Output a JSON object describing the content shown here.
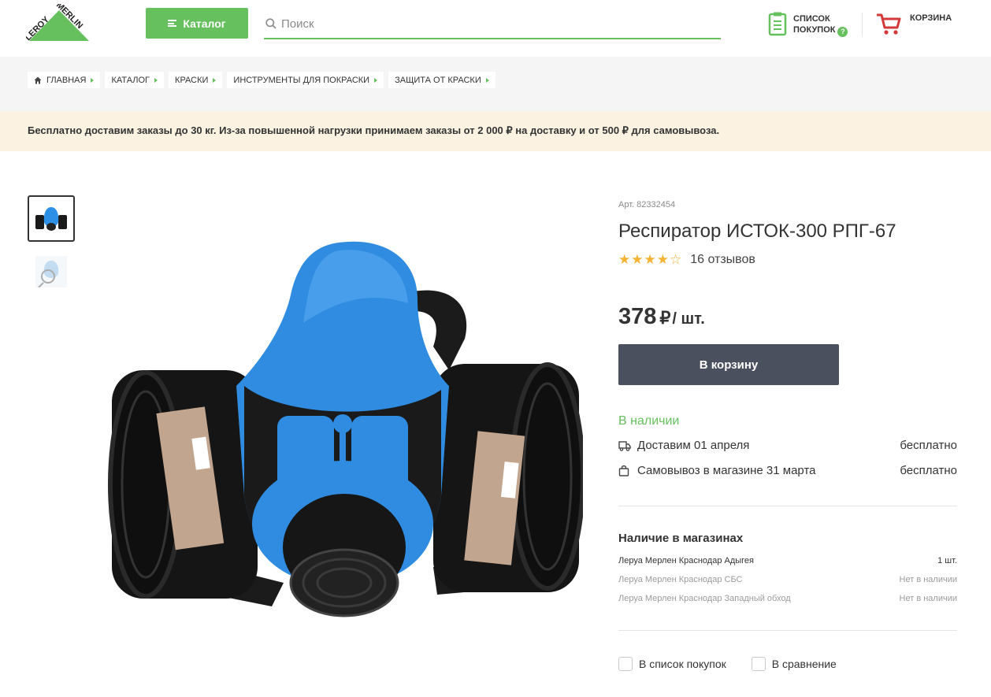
{
  "header": {
    "logo_text": "LEROY MERLIN",
    "catalog_label": "Каталог",
    "search_placeholder": "Поиск",
    "shoplist_line1": "СПИСОК",
    "shoplist_line2": "ПОКУПОК",
    "shoplist_badge": "?",
    "cart_label": "КОРЗИНА"
  },
  "breadcrumbs": [
    "ГЛАВНАЯ",
    "КАТАЛОГ",
    "КРАСКИ",
    "ИНСТРУМЕНТЫ ДЛЯ ПОКРАСКИ",
    "ЗАЩИТА ОТ КРАСКИ"
  ],
  "notice": "Бесплатно доставим заказы до 30 кг. Из-за повышенной нагрузки принимаем заказы от 2 000 ₽ на доставку и от 500 ₽ для самовывоза.",
  "product": {
    "article": "Арт. 82332454",
    "title": "Респиратор ИСТОК-300 РПГ-67",
    "rating": 4,
    "rating_max": 5,
    "reviews": "16 отзывов",
    "price": "378",
    "currency": "₽",
    "unit": "/ шт.",
    "buy_label": "В корзину",
    "stock": "В наличии",
    "delivery": [
      {
        "icon": "truck-icon",
        "text": "Доставим 01 апреля",
        "cost": "бесплатно"
      },
      {
        "icon": "bag-icon",
        "text": "Самовывоз в магазине 31 марта",
        "cost": "бесплатно"
      }
    ],
    "stores_title": "Наличие в магазинах",
    "stores": [
      {
        "name": "Леруа Мерлен Краснодар Адыгея",
        "qty": "1 шт."
      },
      {
        "name": "Леруа Мерлен Краснодар СБС",
        "qty": "Нет в наличии"
      },
      {
        "name": "Леруа Мерлен Краснодар Западный обход",
        "qty": "Нет в наличии"
      }
    ],
    "add_to_list": "В список покупок",
    "compare": "В сравнение"
  },
  "colors": {
    "brand_green": "#66c05d",
    "button_dark": "#4b505e",
    "notice_bg": "#fbf2e1",
    "star": "#f5b335",
    "cart_red": "#d23a3a"
  }
}
